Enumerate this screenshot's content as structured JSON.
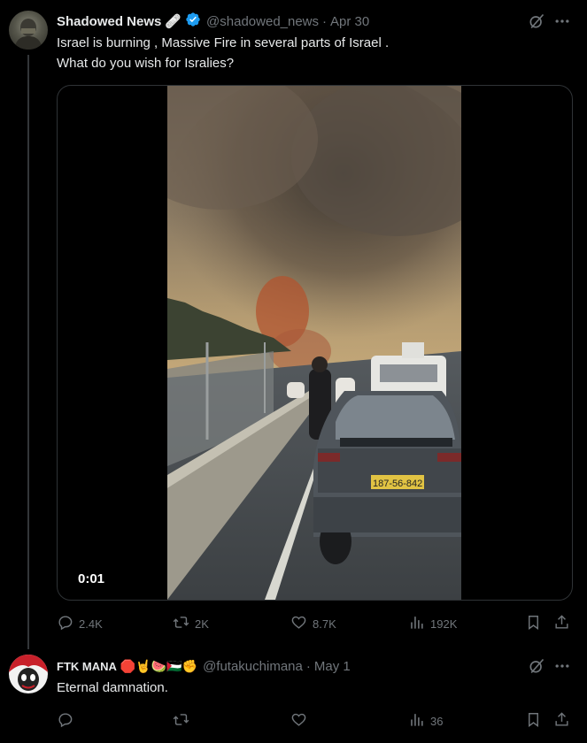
{
  "post": {
    "author_name": "Shadowed News",
    "author_emoji": "🩹",
    "handle": "@shadowed_news",
    "separator": "·",
    "date": "Apr 30",
    "text_line1": "Israel is burning , Massive Fire in several parts of Israel .",
    "text_line2": "What do you wish for Isralies?",
    "video_time": "0:01",
    "video_plate": "187-56-842",
    "stats": {
      "replies": "2.4K",
      "reposts": "2K",
      "likes": "8.7K",
      "views": "192K"
    }
  },
  "reply": {
    "author_name": "FTK MANA",
    "author_emojis": "🛑🤘🍉🇵🇸✊",
    "handle": "@futakuchimana",
    "separator": "·",
    "date": "May 1",
    "text": "Eternal damnation.",
    "stats": {
      "replies": "",
      "reposts": "",
      "likes": "",
      "views": "36"
    }
  },
  "colors": {
    "background": "#000000",
    "text": "#e7e9ea",
    "muted": "#71767b",
    "verified": "#1d9bf0",
    "border": "#2f3336"
  },
  "icons": [
    "grok-icon",
    "more-icon",
    "reply-icon",
    "repost-icon",
    "like-icon",
    "views-icon",
    "bookmark-icon",
    "share-icon",
    "verified-badge-icon"
  ]
}
